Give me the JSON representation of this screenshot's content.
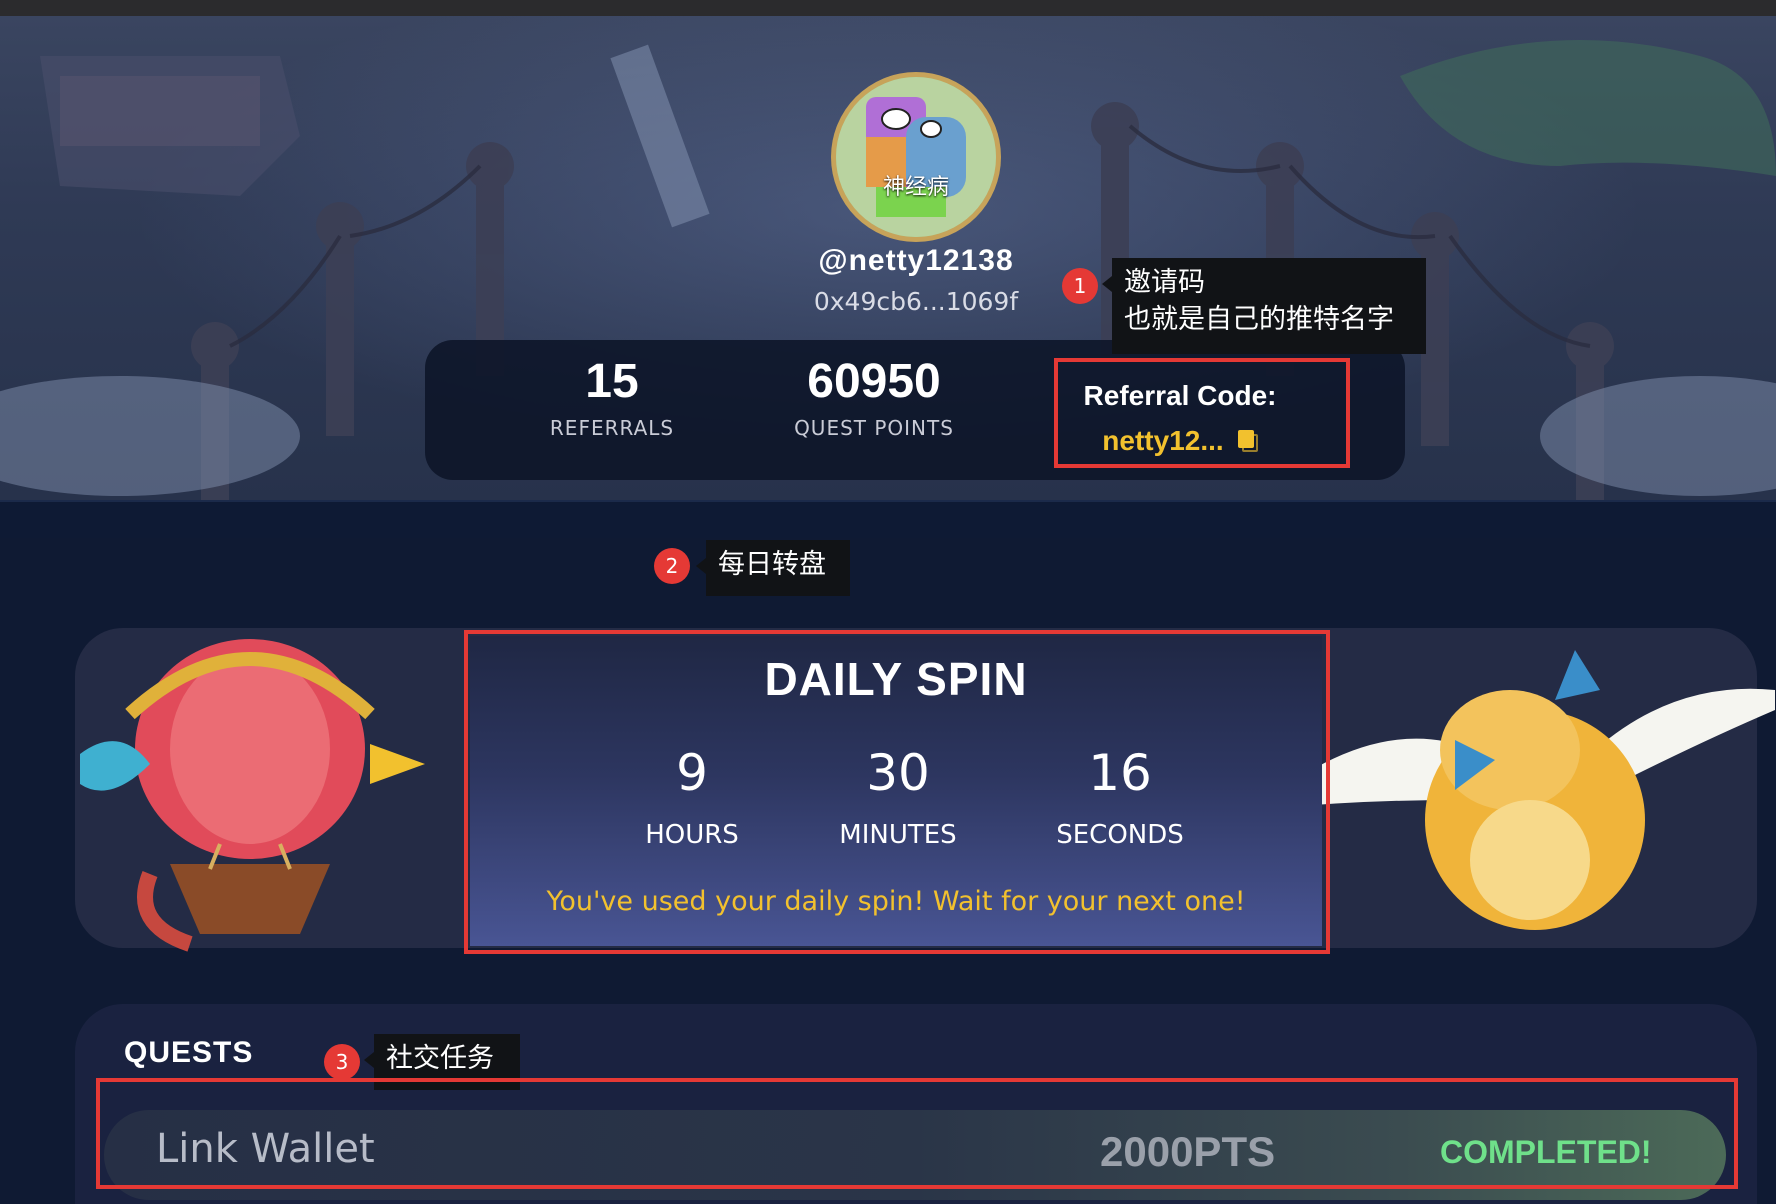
{
  "profile": {
    "avatar_caption": "神经病",
    "username": "@netty12138",
    "address": "0x49cb6...1069f"
  },
  "stats": {
    "referrals": {
      "value": "15",
      "label": "REFERRALS"
    },
    "quest_points": {
      "value": "60950",
      "label": "QUEST POINTS"
    },
    "referral_code": {
      "label": "Referral Code:",
      "value": "netty12..."
    }
  },
  "annotations": {
    "a1": {
      "badge": "1",
      "line1": "邀请码",
      "line2": "也就是自己的推特名字"
    },
    "a2": {
      "badge": "2",
      "text": "每日转盘"
    },
    "a3": {
      "badge": "3",
      "text": "社交任务"
    }
  },
  "daily_spin": {
    "title": "DAILY SPIN",
    "hours": {
      "value": "9",
      "label": "HOURS"
    },
    "minutes": {
      "value": "30",
      "label": "MINUTES"
    },
    "seconds": {
      "value": "16",
      "label": "SECONDS"
    },
    "message": "You've used your daily spin! Wait for your next one!"
  },
  "quests": {
    "title": "QUESTS",
    "items": [
      {
        "name": "Link Wallet",
        "points": "2000PTS",
        "status": "COMPLETED!"
      }
    ]
  },
  "colors": {
    "accent_gold": "#f2c12e",
    "annotation_red": "#e53935",
    "completed_green": "#6fe08a"
  }
}
